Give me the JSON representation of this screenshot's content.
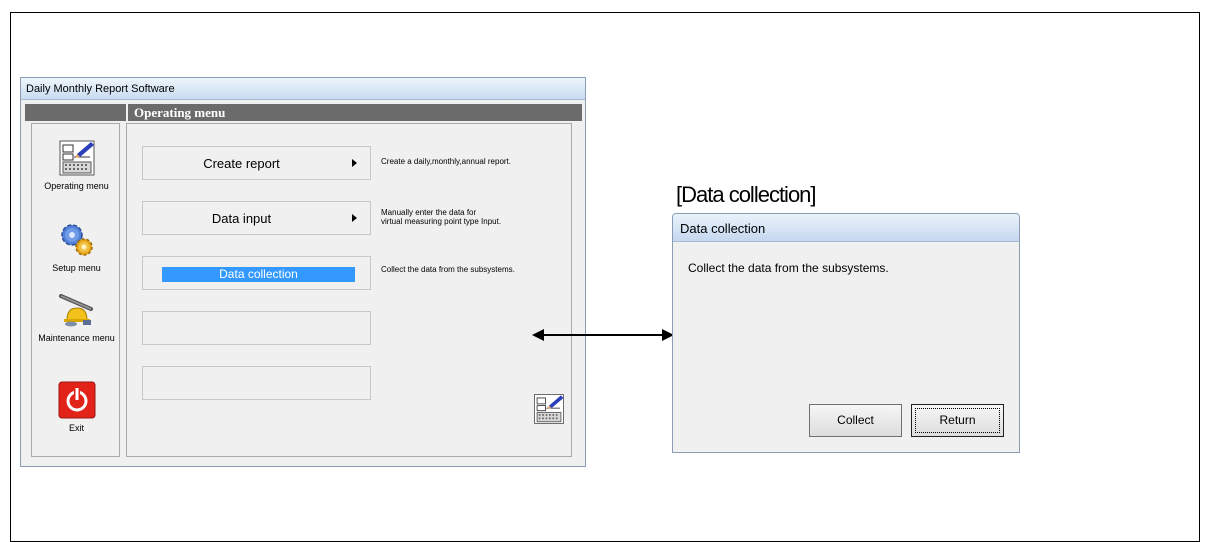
{
  "window": {
    "title": "Daily Monthly Report Software",
    "header": "Operating menu"
  },
  "sidebar": {
    "items": [
      {
        "label": "Operating menu",
        "icon": "report-calendar-icon"
      },
      {
        "label": "Setup menu",
        "icon": "gears-icon"
      },
      {
        "label": "Maintenance menu",
        "icon": "tools-helmet-icon"
      },
      {
        "label": "Exit",
        "icon": "power-icon"
      }
    ]
  },
  "menu": {
    "buttons": [
      {
        "label": "Create report",
        "has_arrow": true
      },
      {
        "label": "Data input",
        "has_arrow": true
      },
      {
        "label": "Data collection",
        "selected": true
      },
      {
        "label": ""
      },
      {
        "label": ""
      }
    ],
    "descriptions": {
      "create_report": "Create a daily,monthly,annual report.",
      "data_input_line1": "Manually enter the data for",
      "data_input_line2": "virtual measuring point type Input.",
      "data_collection": "Collect the data from the subsystems."
    }
  },
  "dialog": {
    "caption": "[Data collection]",
    "title": "Data collection",
    "message": "Collect the data from the subsystems.",
    "collect_label": "Collect",
    "return_label": "Return"
  },
  "colors": {
    "selection": "#3399ff",
    "header_bar": "#6b6b6b",
    "exit_red": "#e2231a"
  }
}
